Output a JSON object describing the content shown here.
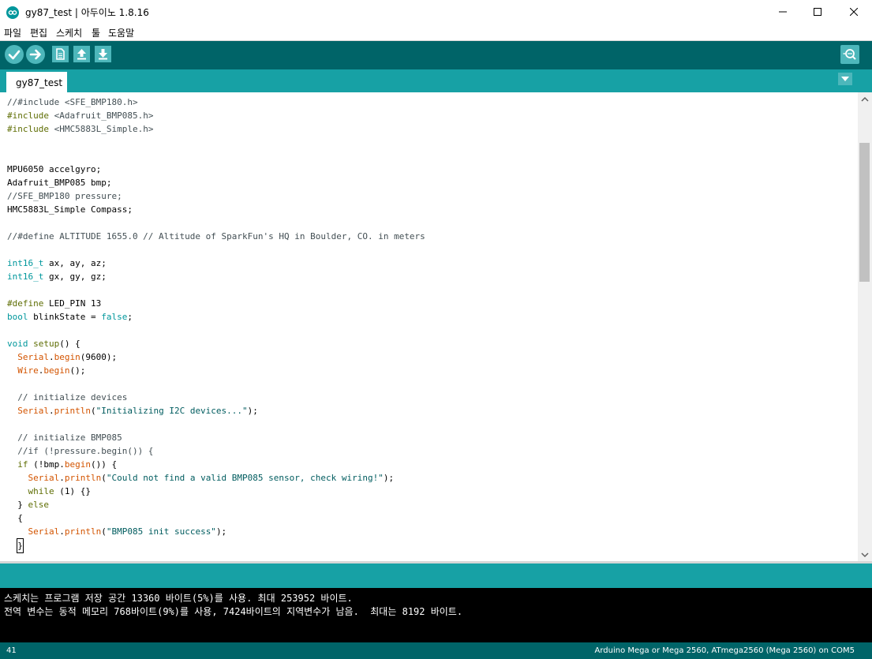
{
  "window": {
    "title": "gy87_test | 아두이노 1.8.16",
    "icon": "arduino-logo-icon",
    "controls": [
      "minimize-icon",
      "maximize-icon",
      "close-icon"
    ]
  },
  "menu": [
    "파일",
    "편집",
    "스케치",
    "툴",
    "도움말"
  ],
  "toolbar": {
    "buttons": [
      "verify-icon",
      "upload-icon",
      "new-sketch-icon",
      "open-sketch-icon",
      "save-sketch-icon",
      "serial-monitor-icon"
    ]
  },
  "tab": {
    "label": "gy87_test"
  },
  "code": [
    [
      [
        "//#include <SFE_BMP180.h>",
        "comment"
      ]
    ],
    [
      [
        "#include",
        "directive"
      ],
      [
        " <Adafruit_BMP085.h>",
        "comment"
      ]
    ],
    [
      [
        "#include",
        "directive"
      ],
      [
        " <HMC5883L_Simple.h>",
        "comment"
      ]
    ],
    [],
    [],
    [
      [
        "MPU6050 accelgyro;",
        ""
      ]
    ],
    [
      [
        "Adafruit_BMP085 bmp;",
        ""
      ]
    ],
    [
      [
        "//SFE_BMP180 pressure;",
        "comment"
      ]
    ],
    [
      [
        "HMC5883L_Simple Compass;",
        ""
      ]
    ],
    [],
    [
      [
        "//#define ALTITUDE 1655.0 // Altitude of SparkFun's HQ in Boulder, CO. in meters",
        "comment"
      ]
    ],
    [],
    [
      [
        "int16_t",
        "type"
      ],
      [
        " ax, ay, az;",
        ""
      ]
    ],
    [
      [
        "int16_t",
        "type"
      ],
      [
        " gx, gy, gz;",
        ""
      ]
    ],
    [],
    [
      [
        "#define",
        "directive"
      ],
      [
        " LED_PIN 13",
        ""
      ]
    ],
    [
      [
        "bool",
        "type"
      ],
      [
        " blinkState = ",
        ""
      ],
      [
        "false",
        "type"
      ],
      [
        ";",
        ""
      ]
    ],
    [],
    [
      [
        "void",
        "type"
      ],
      [
        " ",
        ""
      ],
      [
        "setup",
        "kw"
      ],
      [
        "() {",
        ""
      ]
    ],
    [
      [
        "  ",
        ""
      ],
      [
        "Serial",
        "class"
      ],
      [
        ".",
        ""
      ],
      [
        "begin",
        "fn"
      ],
      [
        "(9600);",
        ""
      ]
    ],
    [
      [
        "  ",
        ""
      ],
      [
        "Wire",
        "class"
      ],
      [
        ".",
        ""
      ],
      [
        "begin",
        "fn"
      ],
      [
        "();",
        ""
      ]
    ],
    [],
    [
      [
        "  // initialize devices",
        "comment"
      ]
    ],
    [
      [
        "  ",
        ""
      ],
      [
        "Serial",
        "class"
      ],
      [
        ".",
        ""
      ],
      [
        "println",
        "fn"
      ],
      [
        "(",
        ""
      ],
      [
        "\"Initializing I2C devices...\"",
        "str"
      ],
      [
        ");",
        ""
      ]
    ],
    [],
    [
      [
        "  // initialize BMP085",
        "comment"
      ]
    ],
    [
      [
        "  //if (!pressure.begin()) {",
        "comment"
      ]
    ],
    [
      [
        "  ",
        ""
      ],
      [
        "if",
        "kw"
      ],
      [
        " (!bmp.",
        ""
      ],
      [
        "begin",
        "fn"
      ],
      [
        "()) {",
        ""
      ]
    ],
    [
      [
        "    ",
        ""
      ],
      [
        "Serial",
        "class"
      ],
      [
        ".",
        ""
      ],
      [
        "println",
        "fn"
      ],
      [
        "(",
        ""
      ],
      [
        "\"Could not find a valid BMP085 sensor, check wiring!\"",
        "str"
      ],
      [
        ");",
        ""
      ]
    ],
    [
      [
        "    ",
        ""
      ],
      [
        "while",
        "kw"
      ],
      [
        " (1) {}",
        ""
      ]
    ],
    [
      [
        "  } ",
        ""
      ],
      [
        "else",
        "kw"
      ]
    ],
    [
      [
        "  {",
        ""
      ]
    ],
    [
      [
        "    ",
        ""
      ],
      [
        "Serial",
        "class"
      ],
      [
        ".",
        ""
      ],
      [
        "println",
        "fn"
      ],
      [
        "(",
        ""
      ],
      [
        "\"BMP085 init success\"",
        "str"
      ],
      [
        ");",
        ""
      ]
    ],
    [
      [
        "  ",
        ""
      ],
      [
        "}",
        "caret"
      ]
    ]
  ],
  "console": [
    "스케치는 프로그램 저장 공간 13360 바이트(5%)를 사용. 최대 253952 바이트.",
    "전역 변수는 동적 메모리 768바이트(9%)를 사용, 7424바이트의 지역변수가 남음.  최대는 8192 바이트."
  ],
  "footer": {
    "line": "41",
    "board": "Arduino Mega or Mega 2560, ATmega2560 (Mega 2560) on COM5"
  },
  "colors": {
    "toolbar": "#006468",
    "tabbar": "#17a1a5",
    "button": "#4db7bb",
    "accent": "#00979c"
  }
}
